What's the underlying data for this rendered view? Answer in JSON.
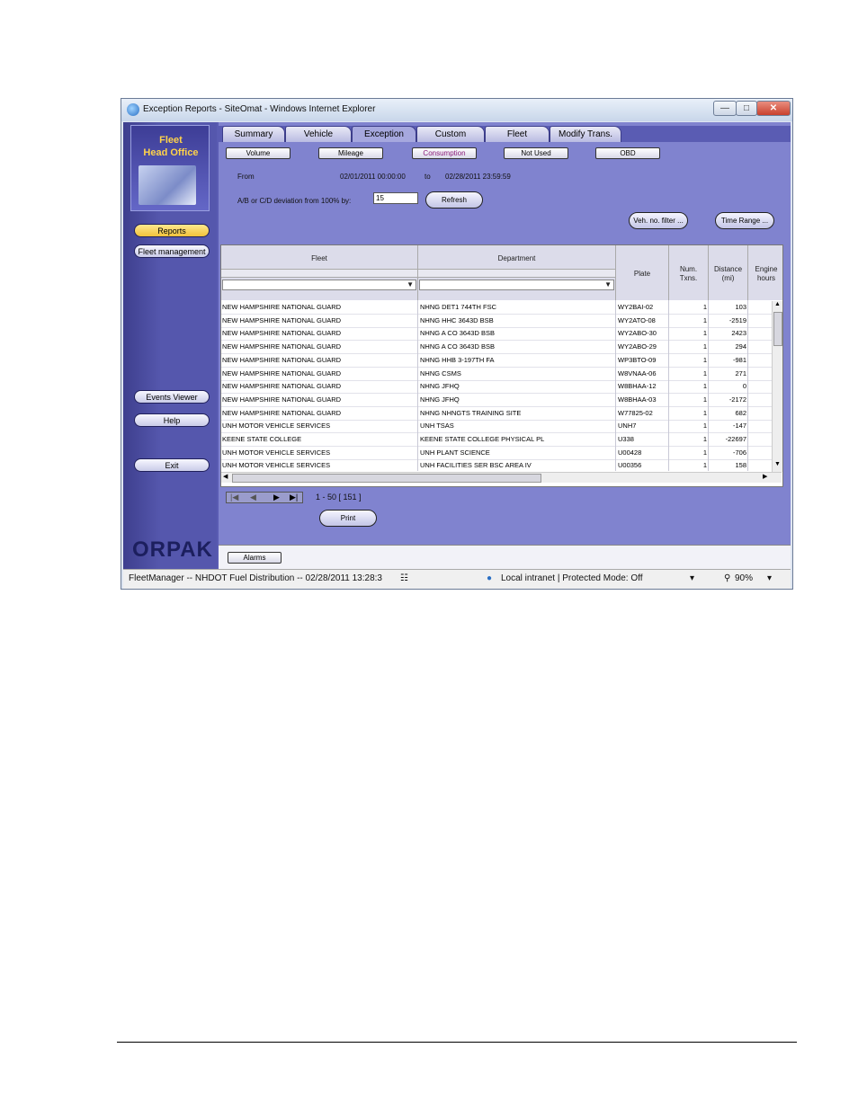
{
  "window": {
    "title": "Exception Reports - SiteOmat - Windows Internet Explorer"
  },
  "sidebar": {
    "logo_line1": "Fleet",
    "logo_line2": "Head Office",
    "reports": "Reports",
    "fleet_management": "Fleet management",
    "events_viewer": "Events Viewer",
    "help": "Help",
    "exit": "Exit",
    "brand": "ORPAK"
  },
  "tabs": [
    "Summary",
    "Vehicle",
    "Exception",
    "Custom",
    "Fleet",
    "Modify Trans."
  ],
  "subtabs": [
    "Volume",
    "Mileage",
    "Consumption",
    "Not Used",
    "OBD"
  ],
  "filters": {
    "from_label": "From",
    "from_value": "02/01/2011 00:00:00",
    "to_label": "to",
    "to_value": "02/28/2011 23:59:59",
    "deviation_label": "A/B or C/D deviation from 100% by:",
    "deviation_value": "15",
    "refresh": "Refresh",
    "veh_filter": "Veh. no. filter ...",
    "time_range": "Time Range ..."
  },
  "table": {
    "headers": {
      "fleet": "Fleet",
      "department": "Department",
      "plate": "Plate",
      "num_txns_1": "Num.",
      "num_txns_2": "Txns.",
      "distance_1": "Distance",
      "distance_2": "(mi)",
      "engine_1": "Engine",
      "engine_2": "hours"
    },
    "rows": [
      [
        "NEW HAMPSHIRE NATIONAL GUARD",
        "NHNG DET1 744TH FSC",
        "WY2BAI-02",
        "1",
        "103"
      ],
      [
        "NEW HAMPSHIRE NATIONAL GUARD",
        "NHNG HHC 3643D BSB",
        "WY2ATO-08",
        "1",
        "-2519"
      ],
      [
        "NEW HAMPSHIRE NATIONAL GUARD",
        "NHNG A CO 3643D BSB",
        "WY2ABO-30",
        "1",
        "2423"
      ],
      [
        "NEW HAMPSHIRE NATIONAL GUARD",
        "NHNG A CO 3643D BSB",
        "WY2ABO-29",
        "1",
        "294"
      ],
      [
        "NEW HAMPSHIRE NATIONAL GUARD",
        "NHNG HHB 3-197TH FA",
        "WP3BTO-09",
        "1",
        "-981"
      ],
      [
        "NEW HAMPSHIRE NATIONAL GUARD",
        "NHNG CSMS",
        "W8VNAA-06",
        "1",
        "271"
      ],
      [
        "NEW HAMPSHIRE NATIONAL GUARD",
        "NHNG JFHQ",
        "W8BHAA-12",
        "1",
        "0"
      ],
      [
        "NEW HAMPSHIRE NATIONAL GUARD",
        "NHNG JFHQ",
        "W8BHAA-03",
        "1",
        "-2172"
      ],
      [
        "NEW HAMPSHIRE NATIONAL GUARD",
        "NHNG NHNGTS TRAINING SITE",
        "W77825-02",
        "1",
        "682"
      ],
      [
        "UNH MOTOR VEHICLE SERVICES",
        "UNH TSAS",
        "UNH7",
        "1",
        "-147"
      ],
      [
        "KEENE STATE COLLEGE",
        "KEENE STATE COLLEGE PHYSICAL PL",
        "U338",
        "1",
        "-22697"
      ],
      [
        "UNH MOTOR VEHICLE SERVICES",
        "UNH PLANT SCIENCE",
        "U00428",
        "1",
        "-706"
      ],
      [
        "UNH MOTOR VEHICLE SERVICES",
        "UNH FACILITIES SER BSC AREA IV",
        "U00356",
        "1",
        "158"
      ]
    ]
  },
  "pager": {
    "range": "1 - 50  [ 151 ]",
    "print": "Print"
  },
  "footer": {
    "alarms": "Alarms"
  },
  "status": {
    "left": "FleetManager -- NHDOT Fuel Distribution -- 02/28/2011  13:28:3",
    "zone": "Local intranet | Protected Mode: Off",
    "zoom": "90%"
  }
}
